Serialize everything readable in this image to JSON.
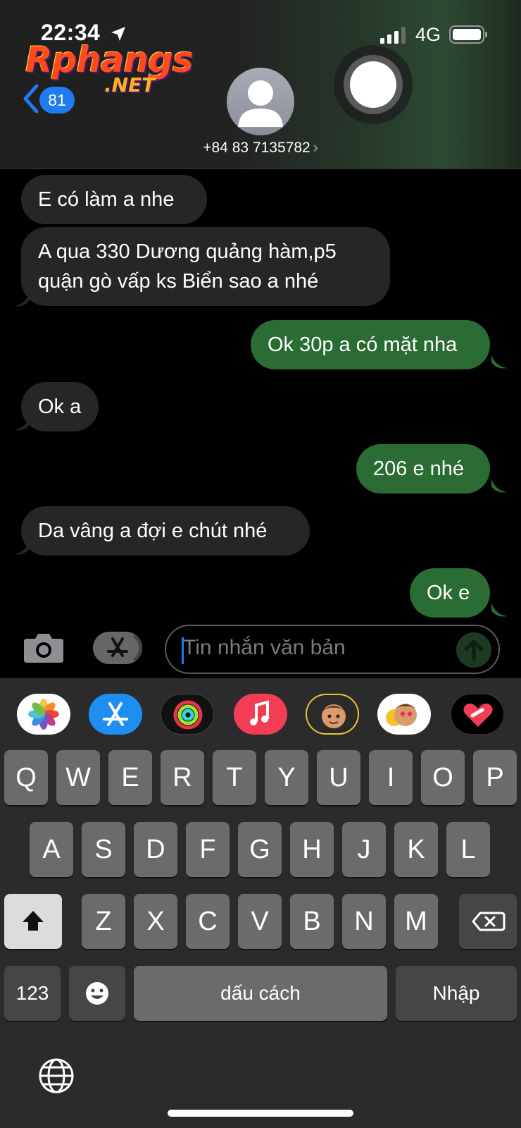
{
  "status_bar": {
    "time": "22:34",
    "network": "4G",
    "location_icon": "location-arrow-icon",
    "signal_icon": "cellular-signal-icon",
    "battery_icon": "battery-icon"
  },
  "watermark": {
    "line1": "Rphangs",
    "line2": ".NET"
  },
  "header": {
    "back_badge": "81",
    "contact_number": "+84 83 7135782",
    "contact_chevron": "›"
  },
  "messages": [
    {
      "direction": "in",
      "text": "E có làm a nhe"
    },
    {
      "direction": "in",
      "text": "A qua 330 Dương quảng hàm,p5 quận gò vấp ks Biển sao a nhé"
    },
    {
      "direction": "out",
      "text": "Ok 30p a có mặt nha"
    },
    {
      "direction": "in",
      "text": "Ok a"
    },
    {
      "direction": "out",
      "text": "206 e nhé"
    },
    {
      "direction": "in",
      "text": "Da vâng a đợi e chút nhé"
    },
    {
      "direction": "out",
      "text": "Ok e"
    }
  ],
  "composer": {
    "placeholder": "Tin nhắn văn bản"
  },
  "app_strip": [
    "photos-app-icon",
    "app-store-icon",
    "activity-rings-icon",
    "music-app-icon",
    "memoji-icon",
    "memoji-stickers-icon",
    "digital-touch-icon"
  ],
  "keyboard": {
    "row1": [
      "Q",
      "W",
      "E",
      "R",
      "T",
      "Y",
      "U",
      "I",
      "O",
      "P"
    ],
    "row2": [
      "A",
      "S",
      "D",
      "F",
      "G",
      "H",
      "J",
      "K",
      "L"
    ],
    "row3": [
      "Z",
      "X",
      "C",
      "V",
      "B",
      "N",
      "M"
    ],
    "numbers_label": "123",
    "space_label": "dấu cách",
    "return_label": "Nhập"
  },
  "colors": {
    "incoming_bubble": "#262628",
    "outgoing_bubble": "#2b6c35",
    "accent": "#1f7cf0"
  }
}
